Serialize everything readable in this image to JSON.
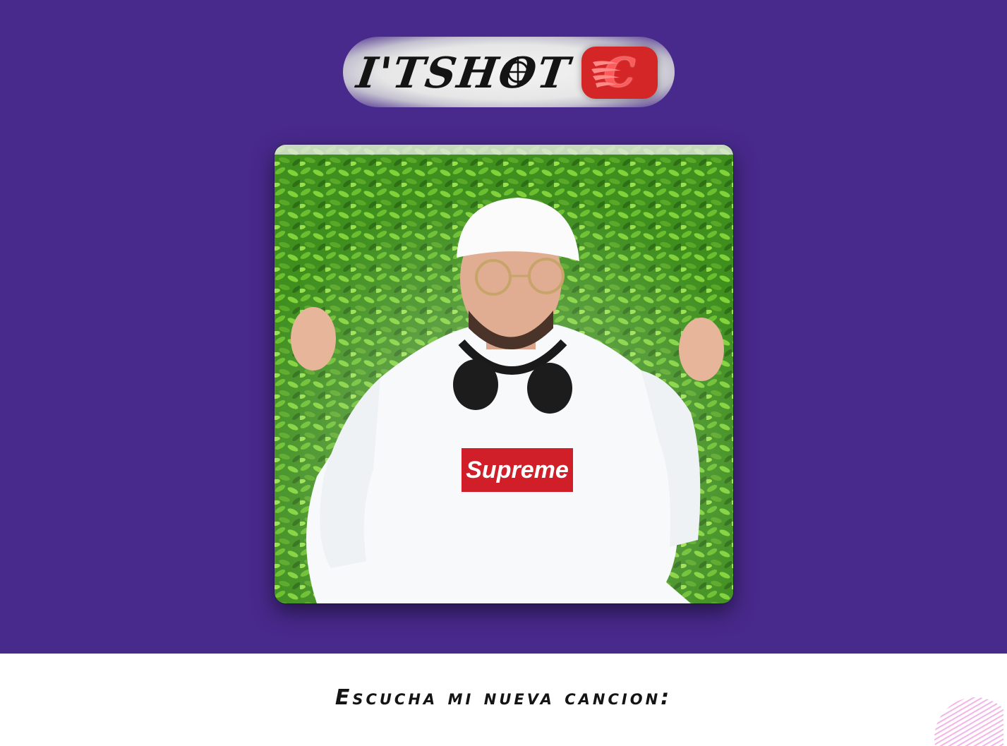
{
  "logo": {
    "text": "I'TSHOT",
    "badge_letter": "C",
    "badge_color": "#d42626",
    "crosshair_icon": "crosshair-icon",
    "flames_icon": "flame-icon"
  },
  "hero": {
    "background": "#48298c"
  },
  "photo": {
    "shirt_brand": "Supreme",
    "shirt_brand_color": "#d11f2a",
    "hedge_color": "#3f8f1f"
  },
  "caption": {
    "text": "Escucha mi nueva cancion:"
  },
  "decoration": {
    "icon": "striped-circle-icon",
    "color": "#f3b5e6"
  }
}
